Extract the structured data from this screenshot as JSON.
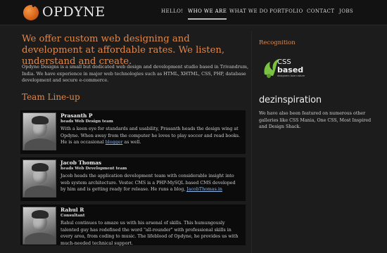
{
  "brand": {
    "name": "OPDYNE"
  },
  "nav": [
    {
      "label": "HELLO!"
    },
    {
      "label": "WHO WE ARE",
      "active": true
    },
    {
      "label": "WHAT WE DO"
    },
    {
      "label": "PORTFOLIO"
    },
    {
      "label": "CONTACT"
    },
    {
      "label": "JOBS"
    }
  ],
  "main": {
    "lead": "We offer custom web designing and development at affordable rates. We listen, understand and create.",
    "intro": "Opdyne Designs is a small but dedicated web design and development studio based in Trivandrum, India. We have experience in major web technologies such as HTML, XHTML, CSS, PHP, database development and secure e-commerce.",
    "team_title": "Team Line-up",
    "team": [
      {
        "name": "Prasanth P",
        "role": "heads Web Design team",
        "bio_before": "With a keen eye for standards and usability, Prasanth heads the design wing at Opdyne. When away from the computer he loves to play soccer and read books. He is an occasional ",
        "link": "blogger",
        "bio_after": " as well."
      },
      {
        "name": "Jacob Thomas",
        "role": "heads Web Development team",
        "bio_before": "Jacob heads the application development team with considerable insight into web system architecture. Vestec CMS is a PHP-MySQL based CMS developed by him and is getting ready for release. He runs a blog, ",
        "link": "JacobThomas.in",
        "bio_after": ""
      },
      {
        "name": "Rahul R",
        "role": "Consultant",
        "bio_before": "Rahul continues to amaze us with his arsenal of skills. This humungously talented guy has redefined the word \"all-rounder\" with professional skills in every area, from coding to music. The lifeblood of Opdyne, he provides us with much-needed technical support.",
        "link": "",
        "bio_after": ""
      }
    ]
  },
  "sidebar": {
    "title": "Recognition",
    "badge1": {
      "main": "CSS",
      "sub": "based",
      "tagline": "designers love nature"
    },
    "badge2": "dezinspiration",
    "text": "We have also been featured on numerous other galleries like CSS Mania, One CSS, Most Inspired and Design Shack."
  },
  "colors": {
    "accent": "#e0874a",
    "background": "#1c1c1c",
    "card": "#0b0b0b",
    "link": "#8fb8e8"
  }
}
